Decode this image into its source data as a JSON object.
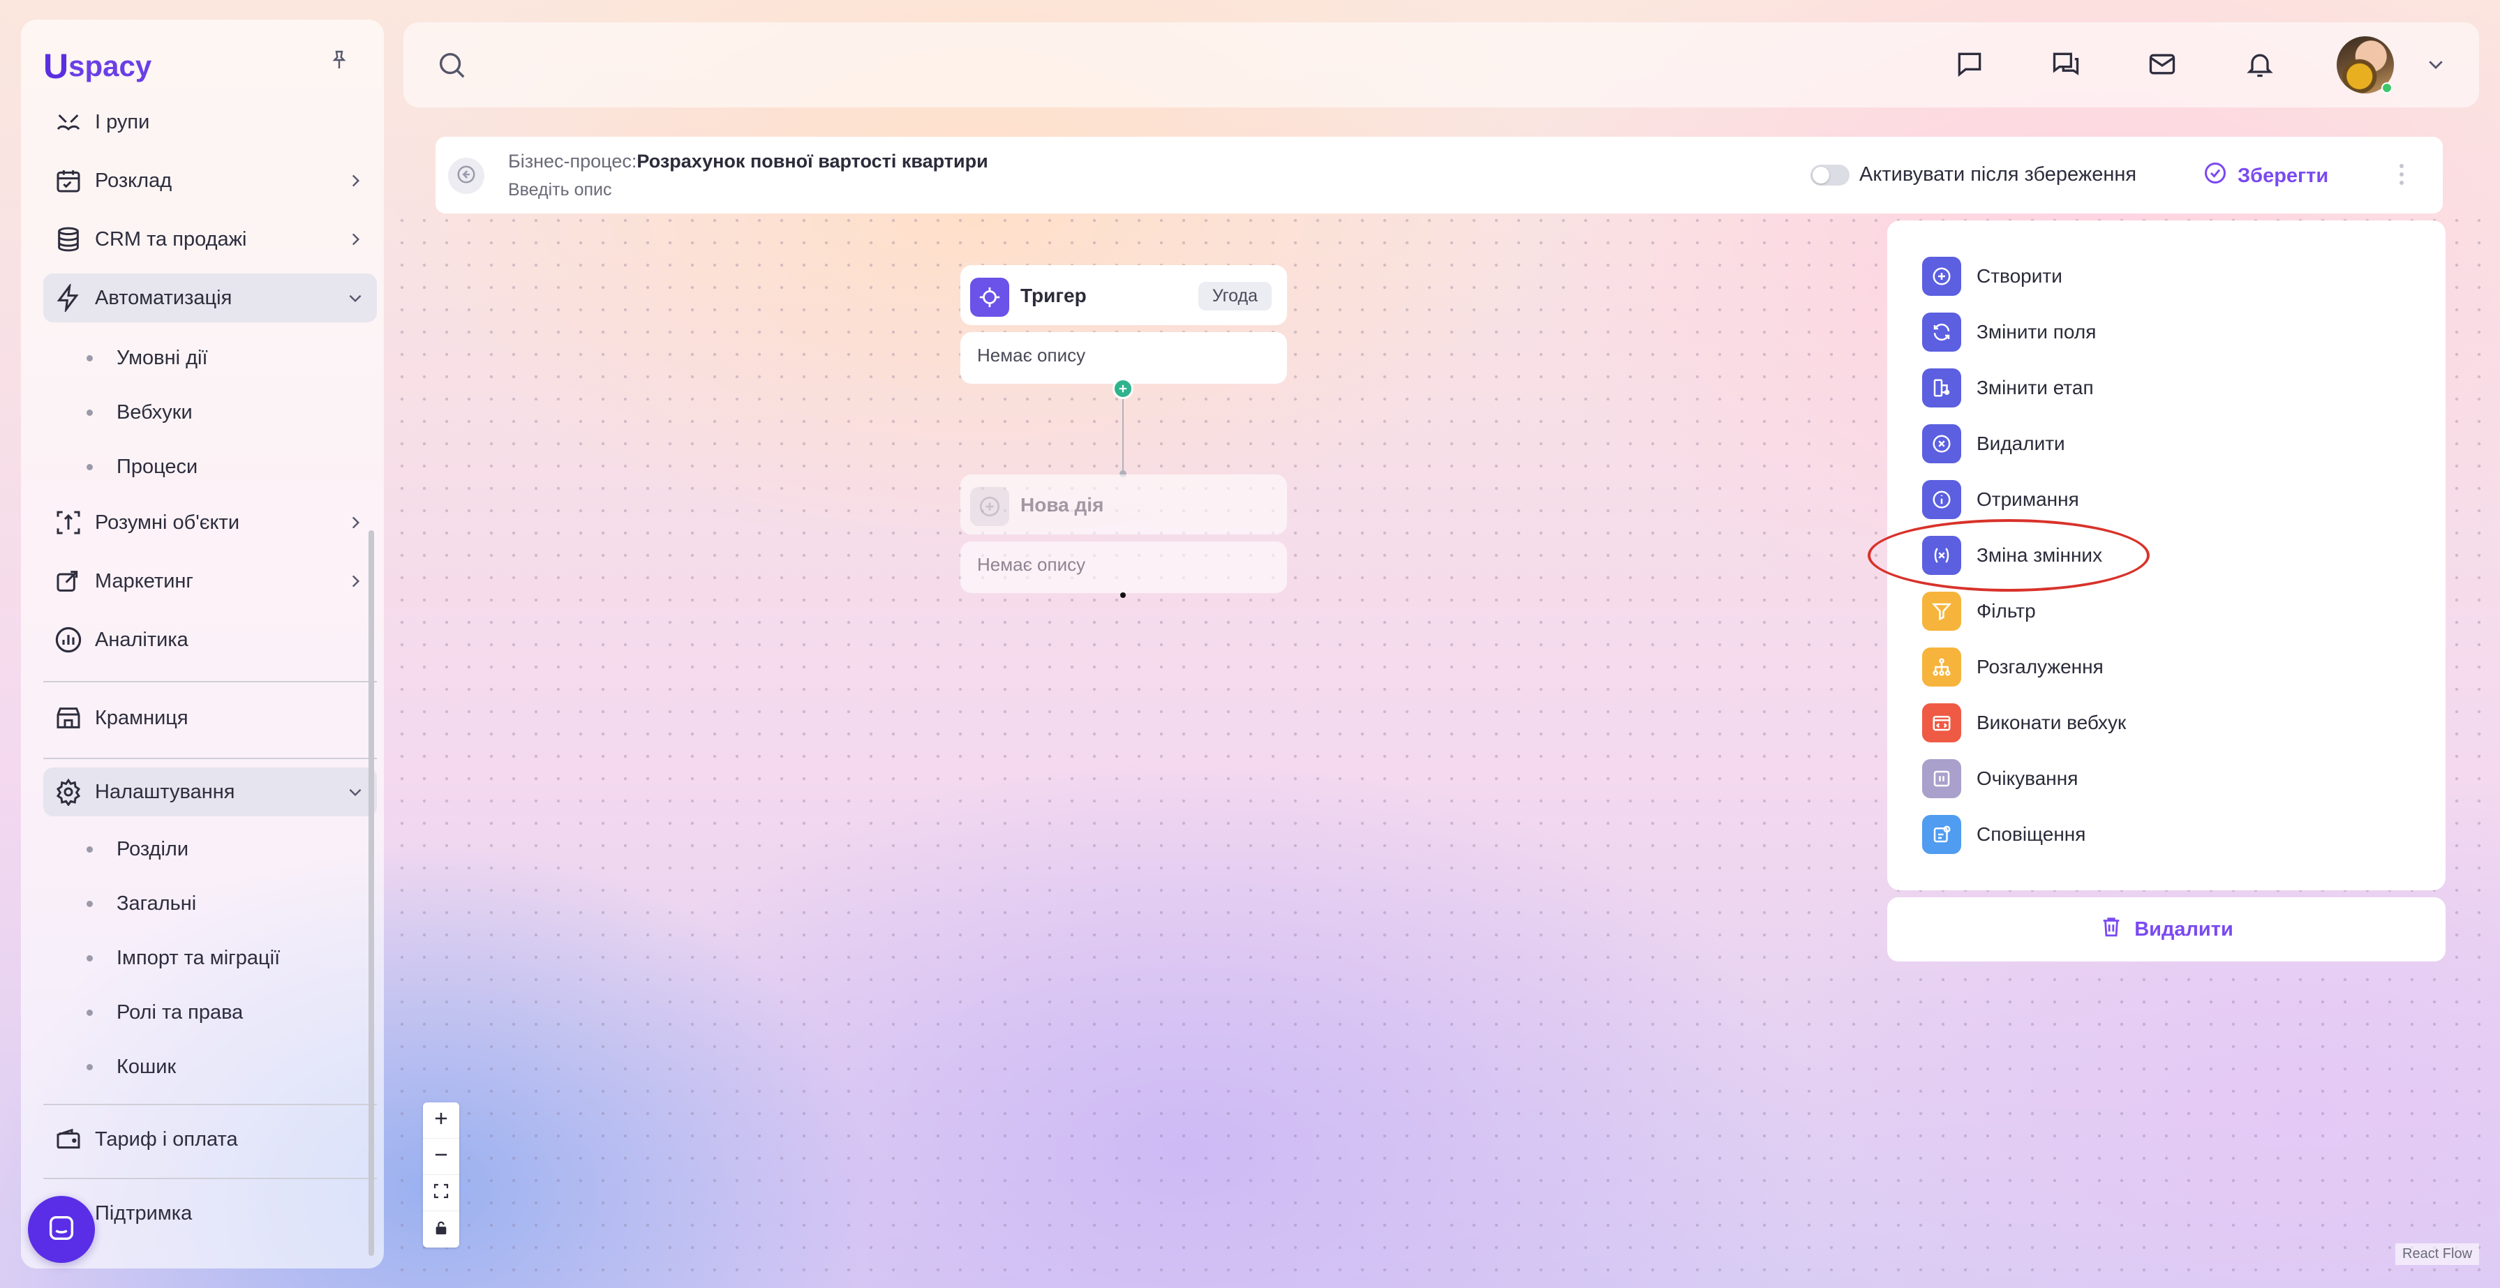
{
  "sidebar": {
    "logo": {
      "mark": "U",
      "text": "spacy"
    },
    "items": [
      {
        "label": "І рупи",
        "icon": "groups-icon"
      },
      {
        "label": "Розклад",
        "icon": "calendar-icon"
      },
      {
        "label": "CRM та продажі",
        "icon": "database-icon"
      },
      {
        "label": "Автоматизація",
        "icon": "lightning-icon"
      },
      {
        "label": "Розумні об'єкти",
        "icon": "smart-object-icon"
      },
      {
        "label": "Маркетинг",
        "icon": "marketing-icon"
      },
      {
        "label": "Аналітика",
        "icon": "analytics-icon"
      },
      {
        "label": "Крамниця",
        "icon": "store-icon"
      },
      {
        "label": "Налаштування",
        "icon": "gear-icon"
      },
      {
        "label": "Тариф і оплата",
        "icon": "wallet-icon"
      },
      {
        "label": "Підтримка",
        "icon": "support-icon"
      }
    ],
    "automation_sub": [
      "Умовні дії",
      "Вебхуки",
      "Процеси"
    ],
    "settings_sub": [
      "Розділи",
      "Загальні",
      "Імпорт та міграції",
      "Ролі та права",
      "Кошик"
    ]
  },
  "process": {
    "prefix": "Бізнес-процес:",
    "name": "Розрахунок повної вартості квартири",
    "description_placeholder": "Введіть опис",
    "activate_label": "Активувати після збереження",
    "activate_on": false,
    "save_label": "Зберегти"
  },
  "flow": {
    "trigger": {
      "title": "Тригер",
      "badge": "Угода",
      "desc": "Немає опису"
    },
    "new_action": {
      "title": "Нова дія",
      "desc": "Немає опису"
    }
  },
  "actions": [
    {
      "label": "Створити",
      "icon": "plus-circle-icon",
      "color": "#5b5fe0"
    },
    {
      "label": "Змінити поля",
      "icon": "refresh-icon",
      "color": "#5b5fe0"
    },
    {
      "label": "Змінити етап",
      "icon": "stage-icon",
      "color": "#5b5fe0"
    },
    {
      "label": "Видалити",
      "icon": "x-circle-icon",
      "color": "#5b5fe0"
    },
    {
      "label": "Отримання",
      "icon": "info-icon",
      "color": "#5b5fe0"
    },
    {
      "label": "Зміна змінних",
      "icon": "variable-icon",
      "color": "#5b5fe0"
    },
    {
      "label": "Фільтр",
      "icon": "filter-icon",
      "color": "#f6b43c"
    },
    {
      "label": "Розгалуження",
      "icon": "branch-icon",
      "color": "#f6b43c"
    },
    {
      "label": "Виконати вебхук",
      "icon": "webhook-icon",
      "color": "#ee5a44"
    },
    {
      "label": "Очікування",
      "icon": "pause-icon",
      "color": "#a9a0cc"
    },
    {
      "label": "Сповіщення",
      "icon": "notification-icon",
      "color": "#4f9cf0"
    }
  ],
  "delete_label": "Видалити",
  "attribution": "React Flow"
}
